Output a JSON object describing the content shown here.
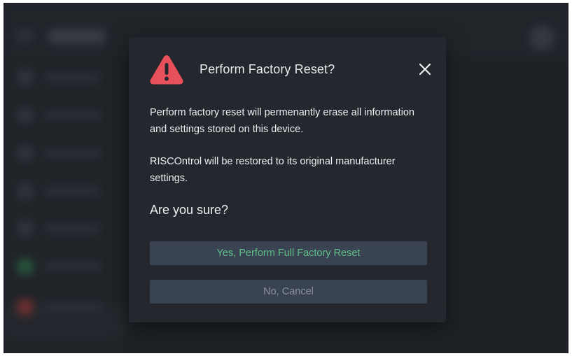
{
  "dialog": {
    "title": "Perform Factory Reset?",
    "paragraph1": "Perform factory reset will permenantly erase all information and settings stored on this device.",
    "paragraph2": "RISCOntrol will be restored to its original manufacturer settings.",
    "question": "Are you sure?",
    "confirm_label": "Yes, Perform Full Factory Reset",
    "cancel_label": "No, Cancel",
    "icons": {
      "warning": "warning-icon",
      "close": "close-icon"
    }
  },
  "colors": {
    "warning_red": "#e8505b",
    "confirm_text": "#5fc08a",
    "cancel_text": "#8a909b",
    "dialog_bg": "#24272d",
    "button_bg": "#3a4352"
  }
}
